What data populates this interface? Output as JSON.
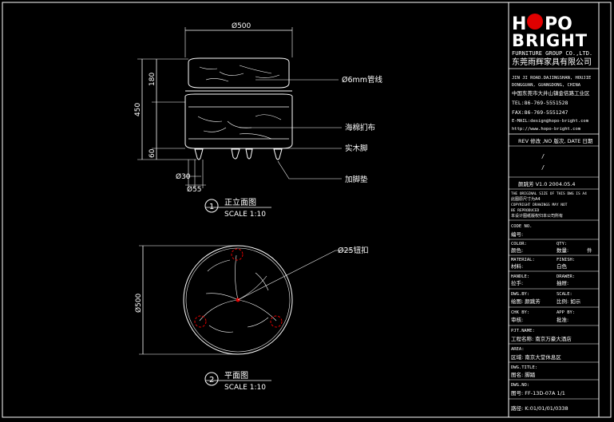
{
  "views": {
    "front": {
      "number": "1",
      "title": "正立面图",
      "scale": "SCALE 1:10",
      "dims": {
        "width": "Ø500",
        "h_top": "180",
        "h_total": "450",
        "h_bottom": "60",
        "foot_small": "Ø30",
        "foot_large": "Ø55"
      },
      "notes": {
        "pipe": "Ø6mm管线",
        "fabric": "海棉扪布",
        "foot": "实木脚",
        "pad": "加脚垫"
      }
    },
    "plan": {
      "number": "2",
      "title": "平面图",
      "scale": "SCALE 1:10",
      "dims": {
        "diameter": "Ø500"
      },
      "notes": {
        "button": "Ø25钮扣"
      }
    }
  },
  "title_block": {
    "logo_top": "HPO",
    "logo_bottom": "BRIGHT",
    "company_en": "FURNITURE GROUP CO.,LTD.",
    "company_cn": "东莞雨辉家具有限公司",
    "address_lines": [
      "JIN JI ROAD.DAJINGSHAN, HOUJIE",
      "DONGGUAN, GUANGDONG, CHINA",
      "中国东莞市大井山镇金佶路工业区",
      "TEL:86-769-5551528",
      "FAX:86-769-5551247",
      "E-MAIL:design@hopo-bright.com",
      "http://www.hopo-bright.com"
    ],
    "rev_header": "REV 修改 ,NO 版次, DATE 日期",
    "rev_marks": [
      "/",
      "/",
      "/"
    ],
    "drawn": "颜跳芳   V1.0    2004.05.4",
    "notes": [
      "THE ORIGINAL SIZE OF THIS DWG IS A4",
      "此图原尺寸为A4",
      "COPYRIGHT DRAWINGS MAY NOT",
      "BE REPRODUCED",
      "本设计图纸版权归本公司所有"
    ],
    "code_no": "CODE NO.",
    "code_cn": "编号:",
    "color": "COLOR:",
    "color_cn": "颜色:",
    "qty": "QTY:",
    "qty_cn": "数量:",
    "qty_val": "件",
    "material": "MATERIAL:",
    "material_cn": "材料:",
    "finish": "FINISH:",
    "finish_cn": "白色",
    "handle": "HANDLE:",
    "handle_cn": "拉手:",
    "drawer": "DRAWER:",
    "drawer_cn": "抽屉:",
    "dwg_by": "DWG.BY:",
    "dwg_by_cn": "绘图: 颜跳芳",
    "scale": "SCALE:",
    "scale_cn": "比例: 如示",
    "chk_by": "CHK BY:",
    "chk_by_cn": "审核:",
    "app_by": "APP BY:",
    "app_by_cn": "批准:",
    "pjt_name": "PJT.NAME:",
    "pjt_name_cn": "工程名称:  南京万豪大酒店",
    "area": "AREA:",
    "area_cn": "区域:     南京大堂休息区",
    "dwg_title": "DWG.TITLE:",
    "dwg_title_cn": "图名:     脚踏",
    "dwg_no": "DWG.NO:",
    "dwg_no_cn": "图号:    FF-13D-07A  1/1",
    "path_cn": "路径:   K:01/01/01/0338"
  }
}
